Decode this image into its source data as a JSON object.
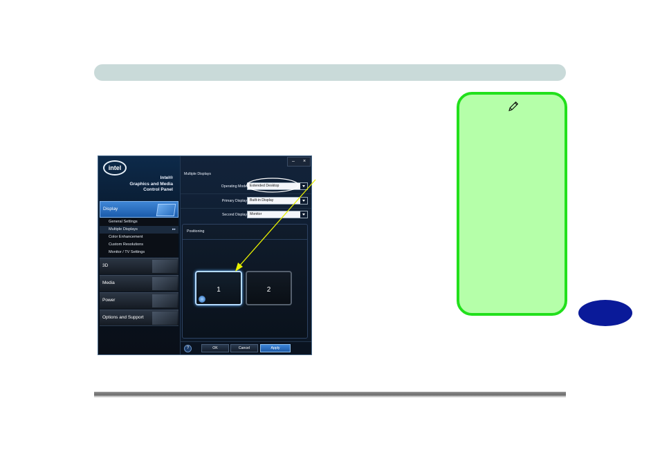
{
  "colors": {
    "header_bar": "#c9dad9",
    "note_fill": "#b5ffa9",
    "note_border": "#22e01c",
    "tab_fill": "#0a1a99",
    "callout": "#e8f000"
  },
  "note": {
    "icon": "pen-icon"
  },
  "panel": {
    "logo_text": "intel",
    "brand_lines": [
      "Intel®",
      "Graphics and Media",
      "Control Panel"
    ],
    "nav": {
      "display": "Display",
      "subitems": [
        "General Settings",
        "Multiple Displays",
        "Color Enhancement",
        "Custom Resolutions",
        "Monitor / TV Settings"
      ],
      "active_marker": "▸▸",
      "categories": [
        "3D",
        "Media",
        "Power",
        "Options and Support"
      ]
    },
    "window_buttons": {
      "minimize": "–",
      "close": "×"
    },
    "main": {
      "title": "Multiple Displays",
      "operating_mode_label": "Operating Mode",
      "operating_mode_value": "Extended Desktop",
      "primary_display_label": "Primary Display",
      "primary_display_value": "Built-in Display",
      "second_display_label": "Second Display",
      "second_display_value": "Monitor",
      "positioning_title": "Positioning",
      "monitor_1": "1",
      "monitor_2": "2"
    },
    "buttons": {
      "help": "?",
      "ok": "OK",
      "cancel": "Cancel",
      "apply": "Apply"
    }
  }
}
